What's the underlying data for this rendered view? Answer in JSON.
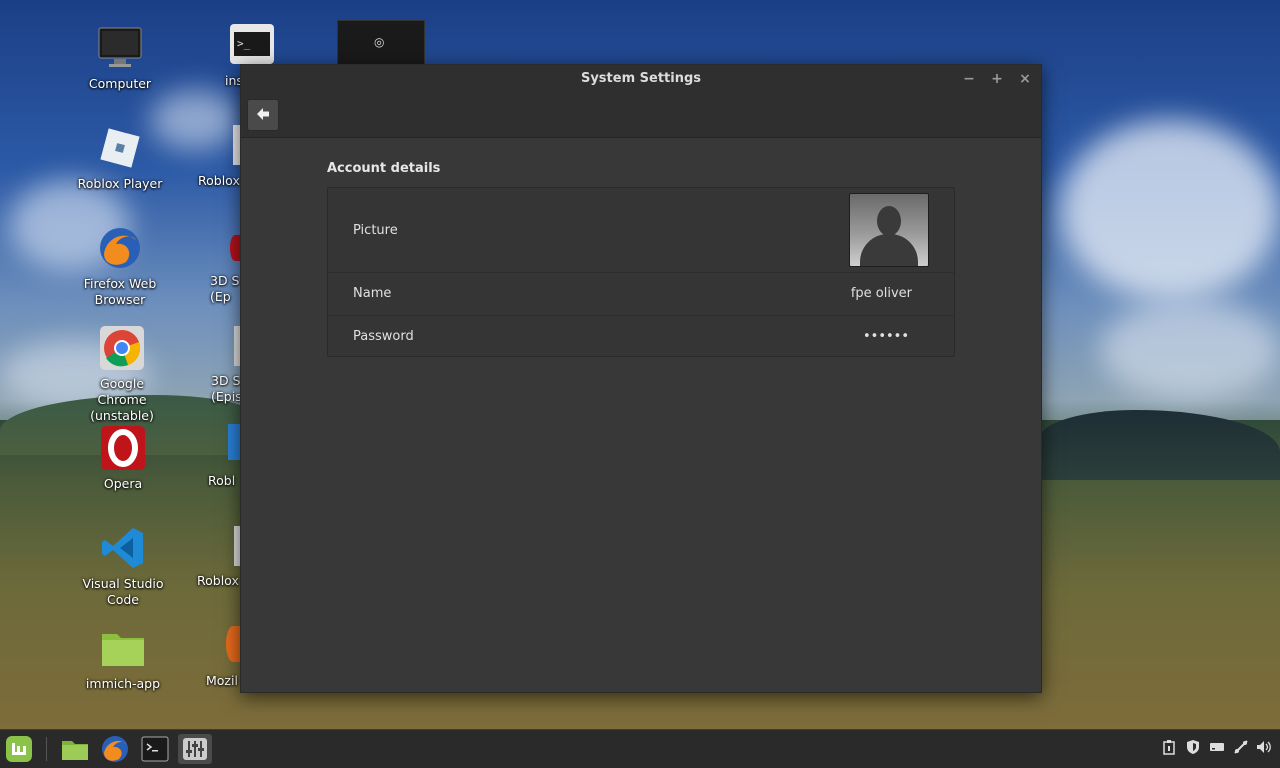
{
  "desktop": {
    "icons": [
      {
        "label": "Computer",
        "icon": "monitor-icon"
      },
      {
        "label": "Roblox Player",
        "icon": "roblox-icon"
      },
      {
        "label": "Firefox Web Browser",
        "icon": "firefox-icon"
      },
      {
        "label": "Google Chrome (unstable)",
        "icon": "chrome-icon"
      },
      {
        "label": "Opera",
        "icon": "opera-icon"
      },
      {
        "label": "Visual Studio Code",
        "icon": "vscode-icon"
      },
      {
        "label": "immich-app",
        "icon": "folder-icon"
      }
    ],
    "partial_icons": [
      {
        "label": "ins",
        "icon": "terminal-icon"
      },
      {
        "label": "Roblox",
        "icon": "roblox-icon"
      },
      {
        "label": "3D S\n(Ep",
        "icon": "app-icon"
      },
      {
        "label": "3D S\n(Epis",
        "icon": "app-icon"
      },
      {
        "label": "Robl",
        "icon": "app-icon"
      },
      {
        "label": "Roblox",
        "icon": "app-icon"
      },
      {
        "label": "Mozil",
        "icon": "firefox-icon"
      }
    ]
  },
  "window": {
    "title": "System Settings",
    "controls": {
      "minimize": "−",
      "maximize": "+",
      "close": "×"
    },
    "back_symbol": "🡠",
    "section_title": "Account details",
    "rows": {
      "picture_label": "Picture",
      "name_label": "Name",
      "name_value": "fpe oliver",
      "password_label": "Password",
      "password_value": "••••••"
    }
  },
  "taskbar": {
    "launchers": [
      "mint-menu-icon",
      "files-icon",
      "firefox-icon",
      "terminal-icon",
      "settings-icon"
    ],
    "tray": [
      "clipboard-icon",
      "shield-icon",
      "drive-icon",
      "network-icon",
      "volume-icon"
    ]
  },
  "colors": {
    "window_bg": "#383838",
    "titlebar_bg": "#2f2f2f",
    "mint_green": "#8bc34a"
  }
}
